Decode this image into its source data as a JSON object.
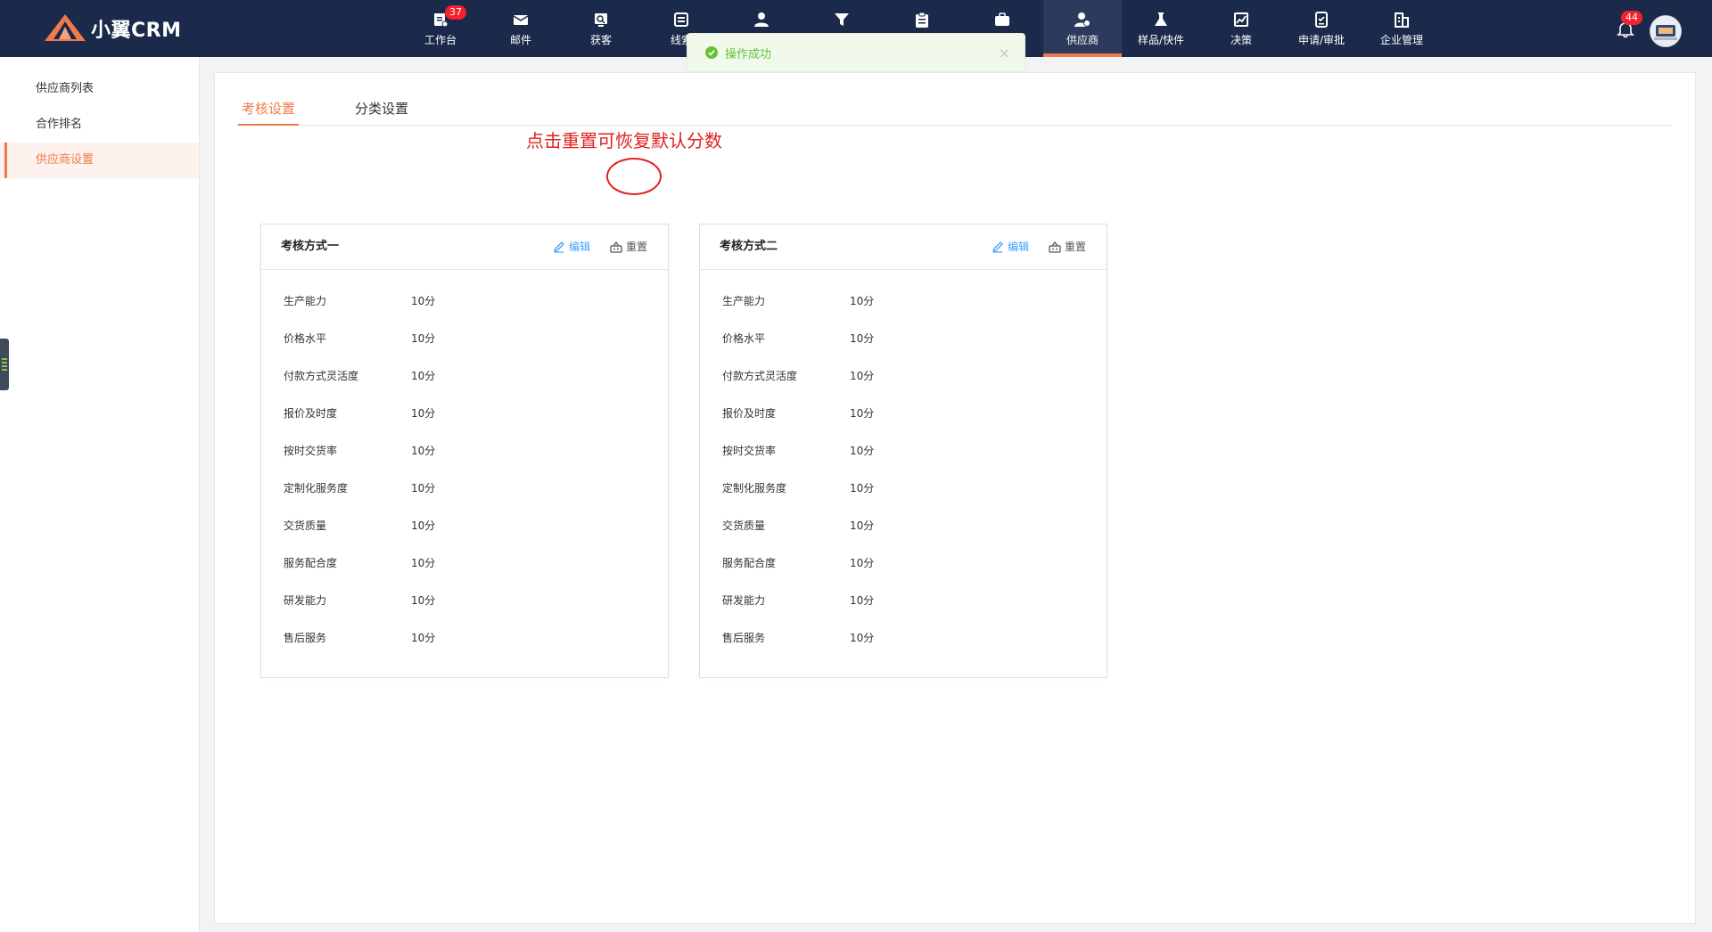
{
  "app": {
    "logo_text": "小翼CRM",
    "brand_color": "#f07a4a"
  },
  "nav": [
    {
      "label": "工作台",
      "icon": "workbench-icon",
      "badge": "37"
    },
    {
      "label": "邮件",
      "icon": "mail-icon"
    },
    {
      "label": "获客",
      "icon": "acquire-icon"
    },
    {
      "label": "线索",
      "icon": "leads-icon"
    },
    {
      "label": "",
      "icon": "customer-icon"
    },
    {
      "label": "",
      "icon": "funnel-icon"
    },
    {
      "label": "",
      "icon": "clipboard-icon"
    },
    {
      "label": "",
      "icon": "briefcase-icon"
    },
    {
      "label": "供应商",
      "icon": "supplier-icon",
      "active": true
    },
    {
      "label": "样品/快件",
      "icon": "flask-icon"
    },
    {
      "label": "决策",
      "icon": "chart-icon"
    },
    {
      "label": "申请/审批",
      "icon": "approval-icon"
    },
    {
      "label": "企业管理",
      "icon": "building-icon"
    }
  ],
  "notifications": {
    "badge": "44"
  },
  "toast": {
    "message": "操作成功"
  },
  "sidebar": {
    "items": [
      {
        "label": "供应商列表"
      },
      {
        "label": "合作排名"
      },
      {
        "label": "供应商设置",
        "active": true
      }
    ]
  },
  "tabs": [
    {
      "label": "考核设置",
      "active": true
    },
    {
      "label": "分类设置"
    }
  ],
  "annotation": "点击重置可恢复默认分数",
  "cards": [
    {
      "title": "考核方式一",
      "edit_label": "编辑",
      "reset_label": "重置",
      "rows": [
        {
          "name": "生产能力",
          "value": "10分"
        },
        {
          "name": "价格水平",
          "value": "10分"
        },
        {
          "name": "付款方式灵活度",
          "value": "10分"
        },
        {
          "name": "报价及时度",
          "value": "10分"
        },
        {
          "name": "按时交货率",
          "value": "10分"
        },
        {
          "name": "定制化服务度",
          "value": "10分"
        },
        {
          "name": "交货质量",
          "value": "10分"
        },
        {
          "name": "服务配合度",
          "value": "10分"
        },
        {
          "name": "研发能力",
          "value": "10分"
        },
        {
          "name": "售后服务",
          "value": "10分"
        }
      ]
    },
    {
      "title": "考核方式二",
      "edit_label": "编辑",
      "reset_label": "重置",
      "rows": [
        {
          "name": "生产能力",
          "value": "10分"
        },
        {
          "name": "价格水平",
          "value": "10分"
        },
        {
          "name": "付款方式灵活度",
          "value": "10分"
        },
        {
          "name": "报价及时度",
          "value": "10分"
        },
        {
          "name": "按时交货率",
          "value": "10分"
        },
        {
          "name": "定制化服务度",
          "value": "10分"
        },
        {
          "name": "交货质量",
          "value": "10分"
        },
        {
          "name": "服务配合度",
          "value": "10分"
        },
        {
          "name": "研发能力",
          "value": "10分"
        },
        {
          "name": "售后服务",
          "value": "10分"
        }
      ]
    }
  ]
}
